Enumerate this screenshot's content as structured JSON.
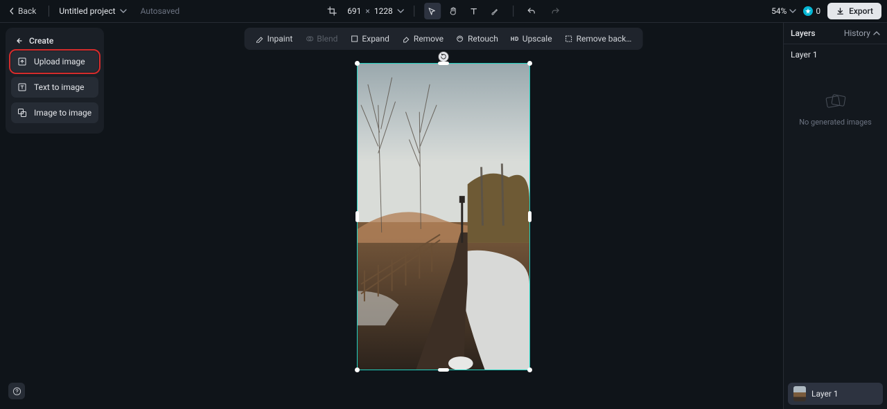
{
  "topbar": {
    "back_label": "Back",
    "project_title": "Untitled project",
    "autosaved": "Autosaved",
    "dimensions": {
      "width": "691",
      "height": "1228",
      "sep": "×"
    },
    "zoom": "54%",
    "credits": "0",
    "export_label": "Export"
  },
  "sec_toolbar": {
    "inpaint": "Inpaint",
    "blend": "Blend",
    "expand": "Expand",
    "remove": "Remove",
    "retouch": "Retouch",
    "upscale": "Upscale",
    "remove_bg": "Remove back…"
  },
  "left_panel": {
    "header": "Create",
    "upload": "Upload image",
    "text_to_image": "Text to image",
    "image_to_image": "Image to image"
  },
  "right_panel": {
    "title": "Layers",
    "history": "History",
    "layer1_top": "Layer 1",
    "empty_msg": "No generated images",
    "layer1_chip": "Layer 1"
  }
}
